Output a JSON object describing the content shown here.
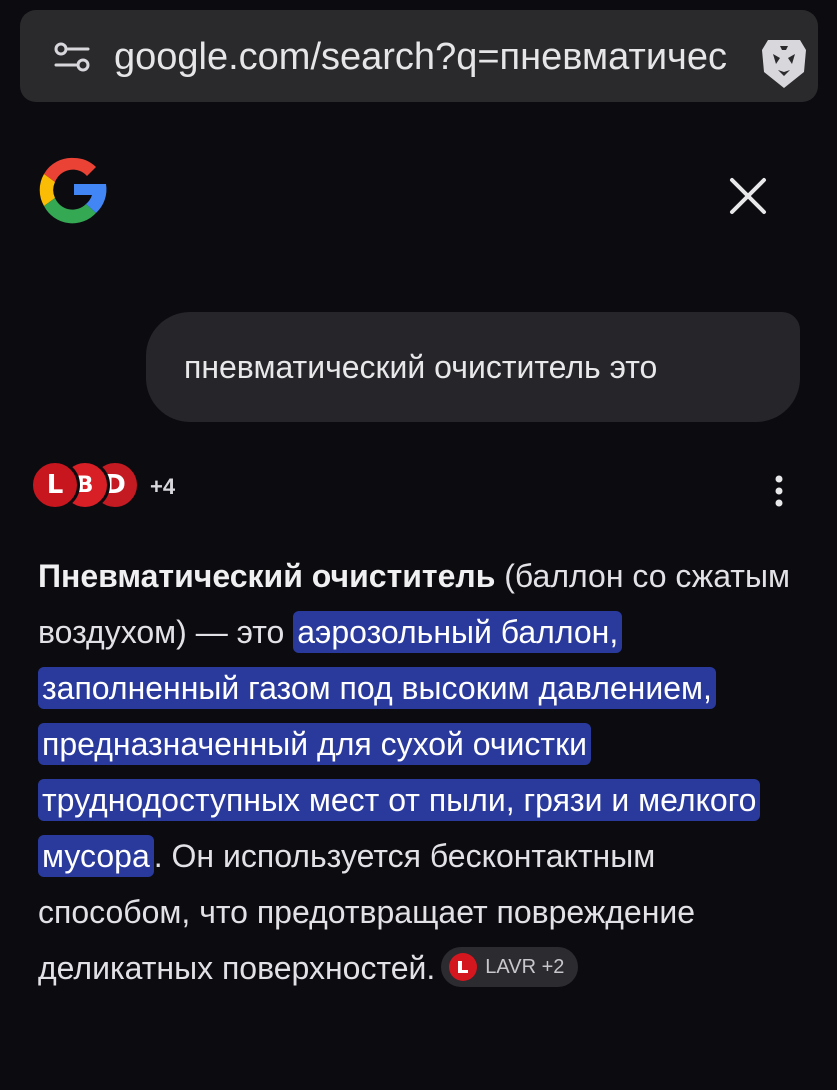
{
  "browser": {
    "url": "google.com/search?q=пневматичес",
    "site_settings_icon": "tune-icon",
    "shield_icon": "brave-lion-icon"
  },
  "header": {
    "logo": "google-g-icon",
    "close_icon": "close-icon"
  },
  "query": {
    "text": "пневматический очиститель это"
  },
  "sources": {
    "badges": [
      {
        "letter": "L",
        "color": "#c8161e"
      },
      {
        "letter": "В",
        "color": "#d81f26"
      },
      {
        "letter": "D",
        "color": "#c41a22"
      }
    ],
    "more_count": "+4",
    "menu_icon": "more-vert-icon"
  },
  "answer": {
    "term": "Пневматический очиститель",
    "intro": " (баллон со сжатым воздухом) — это ",
    "highlight": "аэрозольный баллон, заполненный газом под высоким давлением, предназначенный для сухой очистки труднодоступных мест от пыли, грязи и мелкого мусора",
    "rest": ". Он используется бесконтактным способом, что предотвращает повреждение деликатных поверхностей.",
    "citation": {
      "label": "LAVR +2",
      "icon": "lavr-logo-icon",
      "color": "#d4171f"
    }
  },
  "colors": {
    "background": "#0c0c10",
    "highlight": "#2a3a9c",
    "bubble": "#26262a"
  }
}
